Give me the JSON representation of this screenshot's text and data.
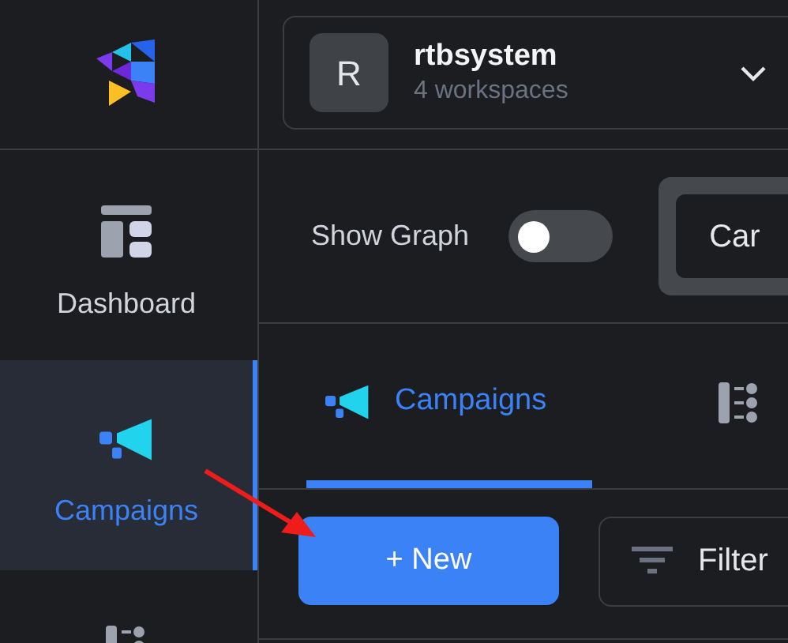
{
  "workspace": {
    "initial": "R",
    "name": "rtbsystem",
    "subtitle": "4 workspaces"
  },
  "sidebar": {
    "items": [
      {
        "kind": "dashboard",
        "label": "Dashboard",
        "selected": false
      },
      {
        "kind": "campaigns",
        "label": "Campaigns",
        "selected": true
      },
      {
        "kind": "list",
        "selected": false
      }
    ]
  },
  "show_graph": {
    "label": "Show Graph",
    "on": false
  },
  "view_button": {
    "label": "Car"
  },
  "tabs": [
    {
      "kind": "campaigns",
      "label": "Campaigns",
      "selected": true
    },
    {
      "kind": "list",
      "selected": false
    }
  ],
  "actions": {
    "new": "+ New",
    "filter": "Filter"
  }
}
